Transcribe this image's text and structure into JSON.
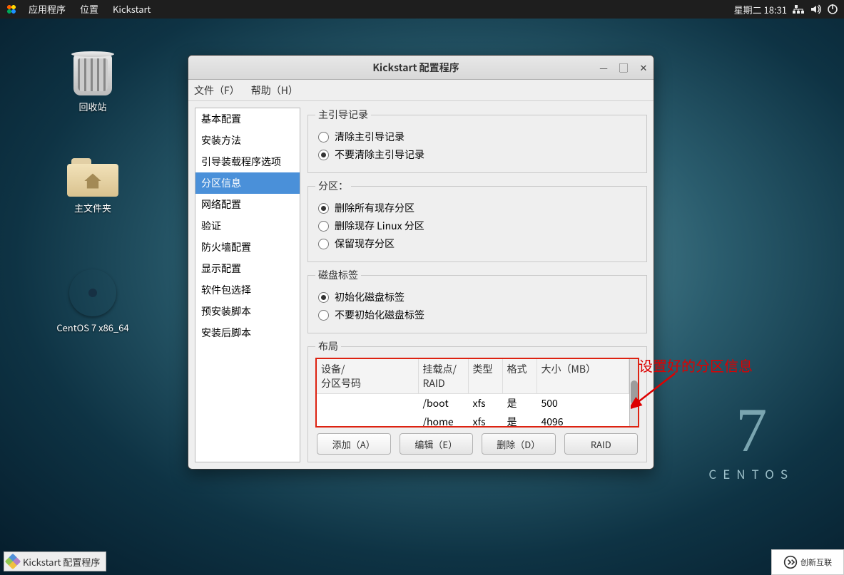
{
  "panel": {
    "menus": {
      "apps": "应用程序",
      "places": "位置",
      "kickstart": "Kickstart"
    },
    "clock": "星期二 18:31"
  },
  "desktop_icons": {
    "trash": "回收站",
    "home": "主文件夹",
    "cd": "CentOS 7 x86_64"
  },
  "centos": {
    "seven": "7",
    "word": "CENTOS"
  },
  "window": {
    "title": "Kickstart 配置程序",
    "menus": {
      "file": "文件（F）",
      "help": "帮助（H）"
    }
  },
  "sidebar": {
    "items": [
      "基本配置",
      "安装方法",
      "引导装载程序选项",
      "分区信息",
      "网络配置",
      "验证",
      "防火墙配置",
      "显示配置",
      "软件包选择",
      "预安装脚本",
      "安装后脚本"
    ],
    "selected_index": 3
  },
  "groups": {
    "mbr": {
      "legend": "主引导记录",
      "options": {
        "clear": "清除主引导记录",
        "keep": "不要清除主引导记录"
      },
      "value": "keep"
    },
    "part": {
      "legend": "分区：",
      "options": {
        "remove_all": "删除所有现存分区",
        "remove_linux": "删除现存  Linux 分区",
        "keep": "保留现存分区"
      },
      "value": "remove_all"
    },
    "label": {
      "legend": "磁盘标签",
      "options": {
        "init": "初始化磁盘标签",
        "noinit": "不要初始化磁盘标签"
      },
      "value": "init"
    },
    "layout": {
      "legend": "布局",
      "headers": {
        "device": "设备/\n分区号码",
        "mount": "挂载点/\nRAID",
        "type": "类型",
        "format": "格式",
        "size": "大小（MB）"
      },
      "rows": [
        {
          "device": "",
          "mount": "/boot",
          "type": "xfs",
          "format": "是",
          "size": "500"
        },
        {
          "device": "",
          "mount": "/home",
          "type": "xfs",
          "format": "是",
          "size": "4096"
        }
      ]
    }
  },
  "buttons": {
    "add": "添加（A）",
    "edit": "编辑（E）",
    "delete": "删除（D）",
    "raid": "RAID"
  },
  "annotation": "设置好的分区信息",
  "taskbar": {
    "app": "Kickstart 配置程序"
  },
  "watermark": "创新互联"
}
